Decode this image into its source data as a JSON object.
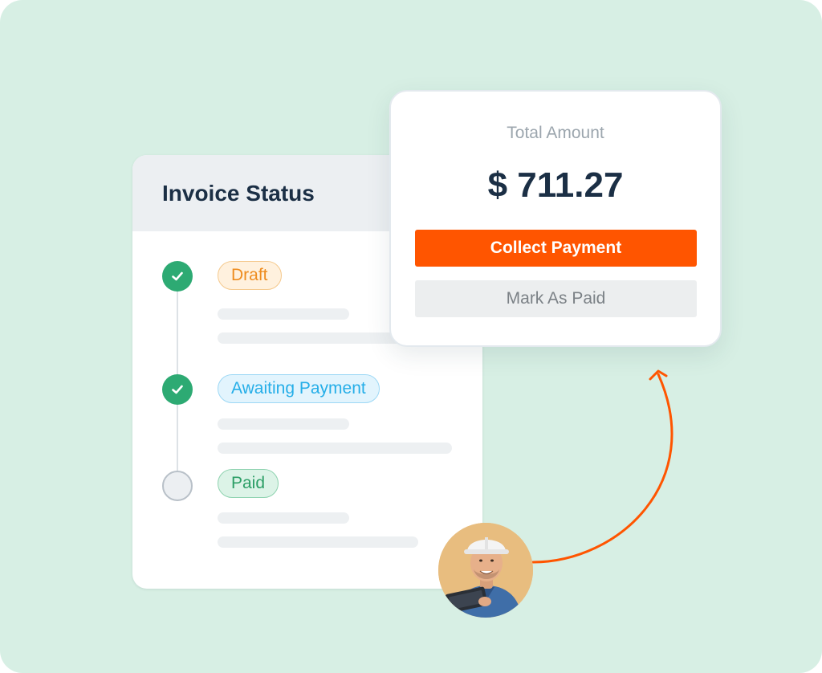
{
  "invoice": {
    "title": "Invoice Status",
    "steps": [
      {
        "label": "Draft",
        "state": "done"
      },
      {
        "label": "Awaiting Payment",
        "state": "done"
      },
      {
        "label": "Paid",
        "state": "pending"
      }
    ]
  },
  "amount_card": {
    "label": "Total Amount",
    "value": "$ 711.27",
    "collect_button": "Collect Payment",
    "mark_paid_button": "Mark As Paid"
  },
  "colors": {
    "background": "#d7efe4",
    "accent": "#ff5500",
    "navy": "#1b2f45",
    "done": "#2daa73"
  },
  "icons": {
    "check": "check-icon",
    "arrow": "curved-arrow-icon",
    "avatar": "worker-avatar"
  }
}
